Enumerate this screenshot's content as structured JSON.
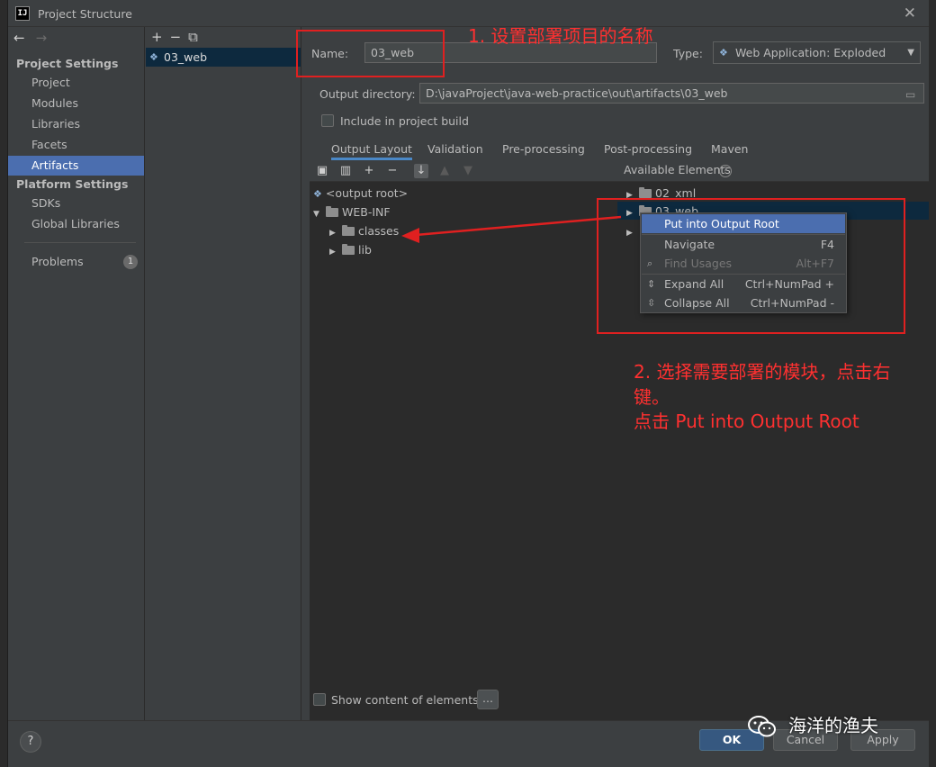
{
  "window": {
    "title": "Project Structure",
    "logo": "IJ"
  },
  "nav": {
    "sections": [
      {
        "title": "Project Settings",
        "items": [
          "Project",
          "Modules",
          "Libraries",
          "Facets",
          "Artifacts"
        ]
      },
      {
        "title": "Platform Settings",
        "items": [
          "SDKs",
          "Global Libraries"
        ]
      }
    ],
    "selected": "Artifacts",
    "problems": {
      "label": "Problems",
      "count": "1"
    }
  },
  "artifacts": {
    "items": [
      "03_web"
    ]
  },
  "artifact": {
    "name_label": "Name:",
    "name_value": "03_web",
    "type_label": "Type:",
    "type_value": "Web Application: Exploded",
    "output_dir_label": "Output directory:",
    "output_dir_value": "D:\\javaProject\\java-web-practice\\out\\artifacts\\03_web",
    "include_build_label": "Include in project build",
    "include_build_checked": false
  },
  "tabs": [
    "Output Layout",
    "Validation",
    "Pre-processing",
    "Post-processing",
    "Maven"
  ],
  "active_tab": "Output Layout",
  "layout_tree": [
    "<output root>",
    "WEB-INF",
    "classes",
    "lib"
  ],
  "available": {
    "header": "Available Elements",
    "items": [
      "02_xml",
      "03_web"
    ]
  },
  "context_menu": [
    {
      "label": "Put into Output Root",
      "shortcut": "",
      "state": "highlighted"
    },
    {
      "label": "Navigate",
      "shortcut": "F4",
      "state": "normal"
    },
    {
      "label": "Find Usages",
      "shortcut": "Alt+F7",
      "state": "disabled"
    },
    {
      "label": "Expand All",
      "shortcut": "Ctrl+NumPad +",
      "state": "normal"
    },
    {
      "label": "Collapse All",
      "shortcut": "Ctrl+NumPad -",
      "state": "normal"
    }
  ],
  "show_content_label": "Show content of elements",
  "ellipsis": "...",
  "buttons": {
    "ok": "OK",
    "cancel": "Cancel",
    "apply": "Apply",
    "help": "?"
  },
  "annotations": {
    "step1": "1. 设置部署项目的名称",
    "step2_line1": "2. 选择需要部署的模块，点击右",
    "step2_line2": "键。",
    "step2_line3": "点击 Put into Output Root",
    "watermark": "海洋的渔夫"
  },
  "colors": {
    "selection": "#4b6eaf",
    "annotation": "#e02020",
    "primary_button": "#365880"
  }
}
